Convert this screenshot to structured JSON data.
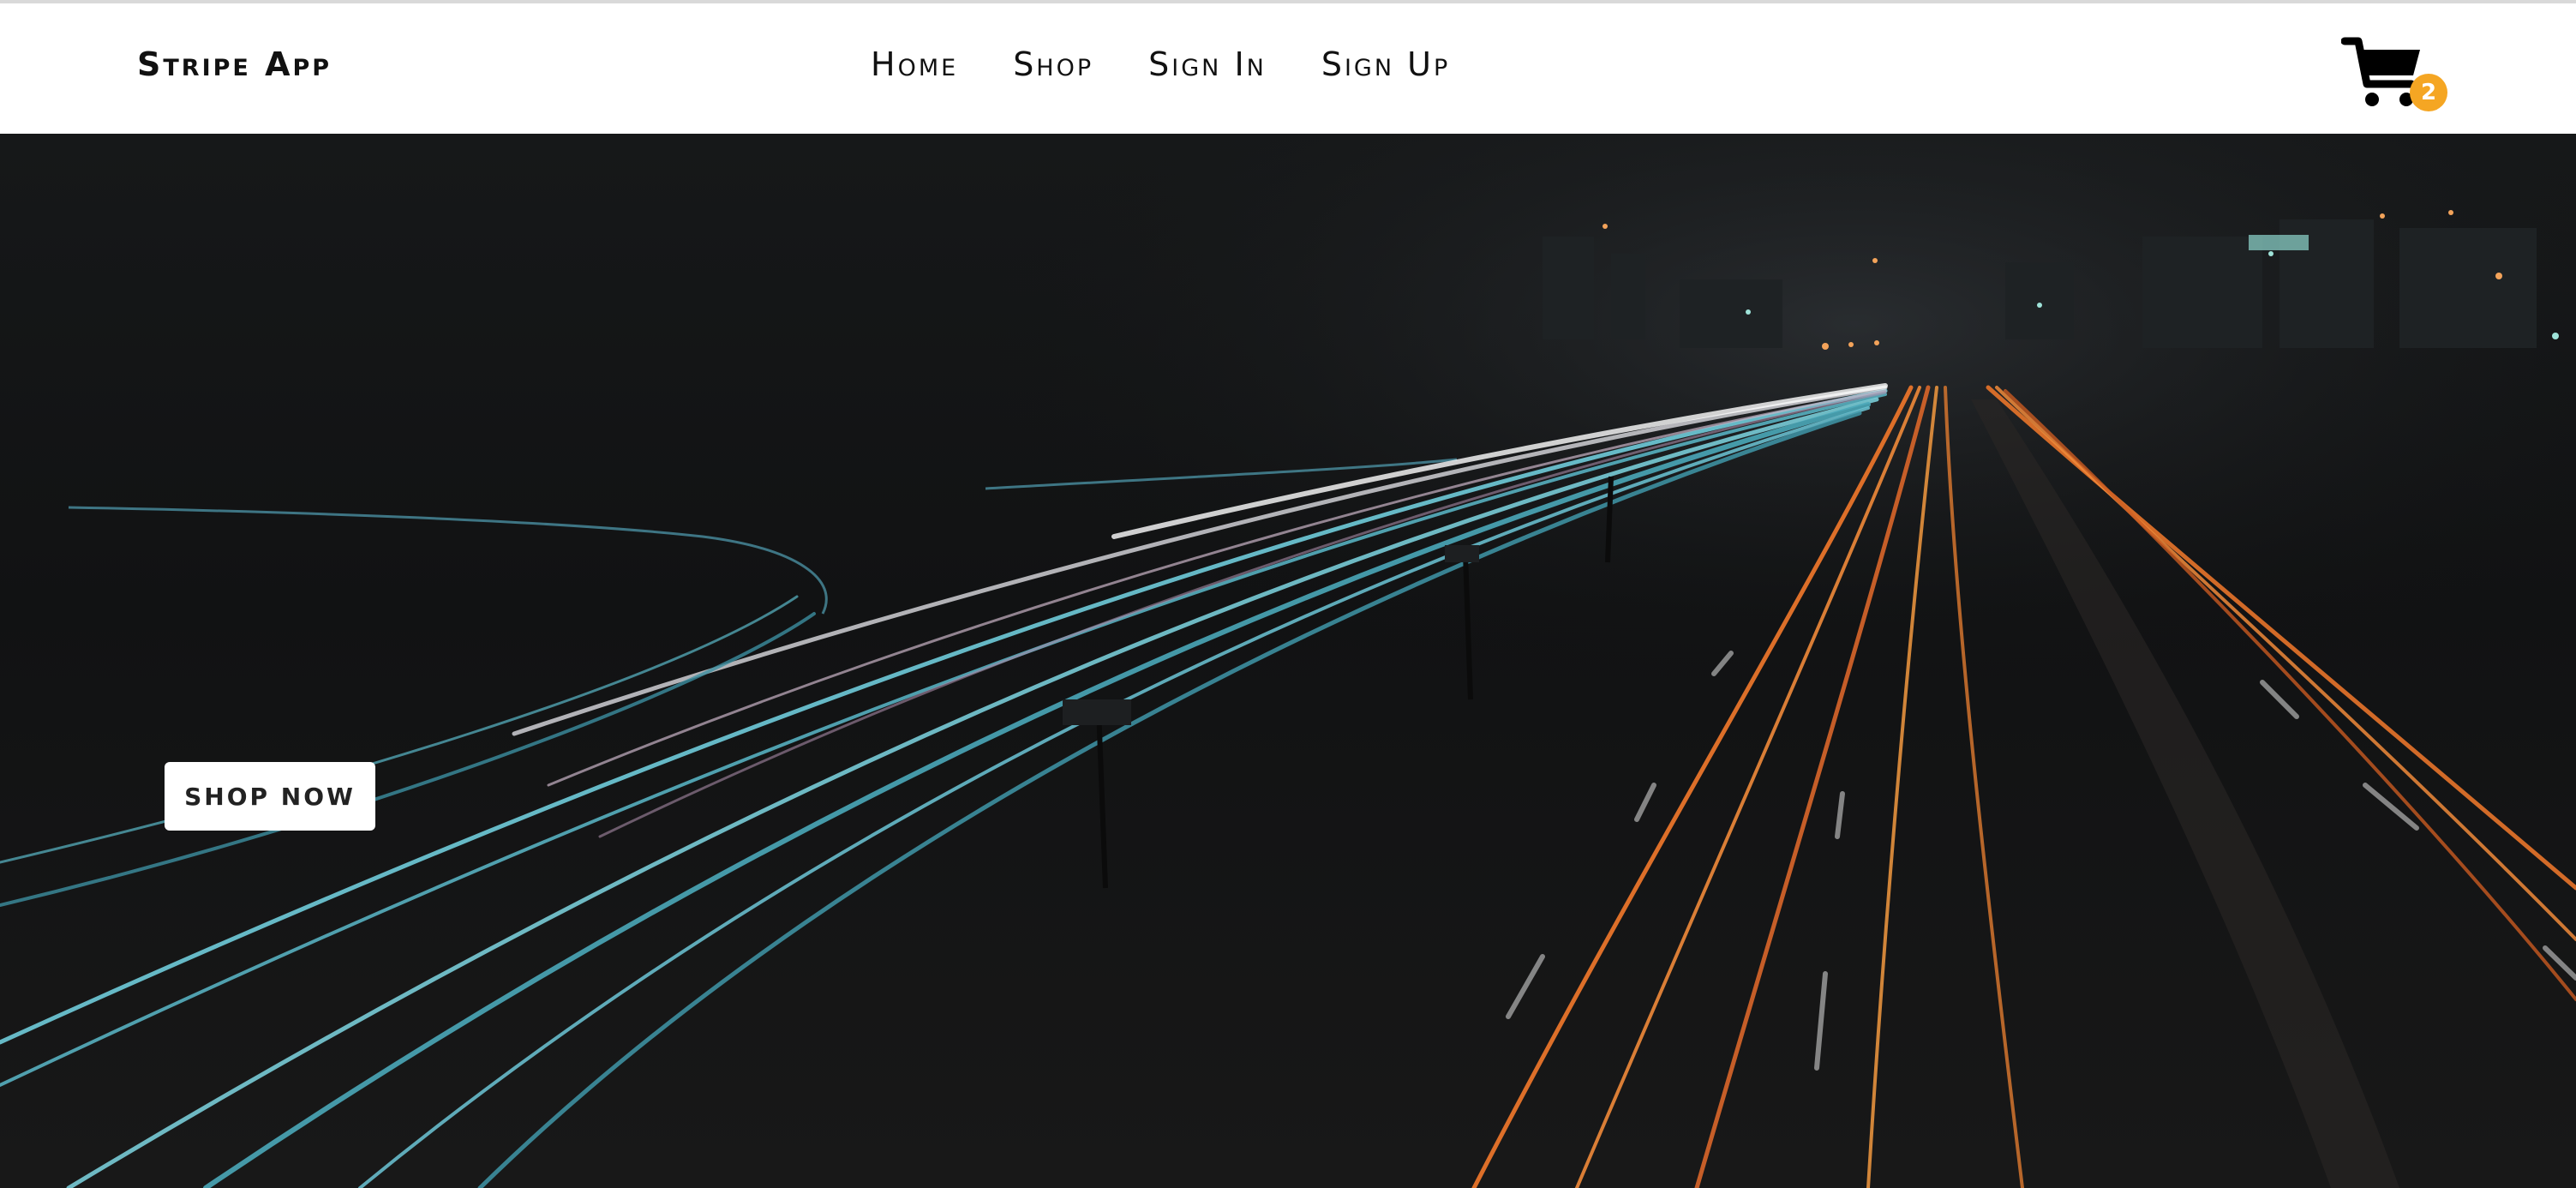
{
  "header": {
    "brand": "Stripe App",
    "nav": {
      "home": "Home",
      "shop": "Shop",
      "sign_in": "Sign In",
      "sign_up": "Sign Up"
    },
    "cart": {
      "icon": "shopping-cart-icon",
      "count": "2",
      "badge_color": "#f5a623"
    }
  },
  "hero": {
    "image": "night highway light trails",
    "cta_label": "SHOP NOW"
  },
  "colors": {
    "header_bg": "#ffffff",
    "hero_bg": "#141516",
    "accent_cyan": "#5fc6d6",
    "accent_orange": "#e8742a"
  }
}
